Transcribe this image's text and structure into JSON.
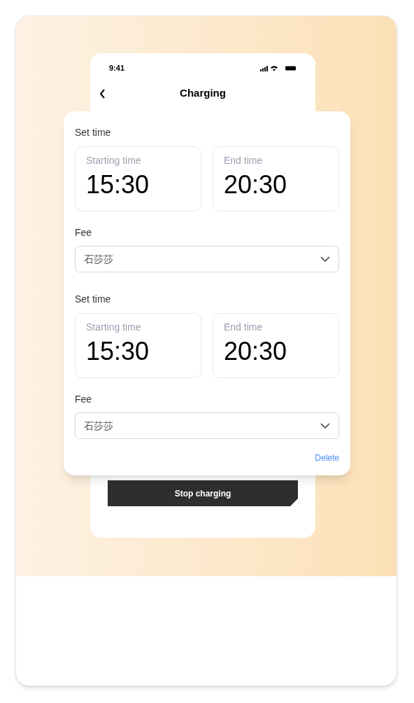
{
  "status_bar": {
    "time": "9:41"
  },
  "nav": {
    "title": "Charging"
  },
  "slots": [
    {
      "heading": "Set time",
      "start": {
        "label": "Starting time",
        "value": "15:30"
      },
      "end": {
        "label": "End time",
        "value": "20:30"
      },
      "fee_label": "Fee",
      "fee_value": "石莎莎"
    },
    {
      "heading": "Set time",
      "start": {
        "label": "Starting time",
        "value": "15:30"
      },
      "end": {
        "label": "End time",
        "value": "20:30"
      },
      "fee_label": "Fee",
      "fee_value": "石莎莎"
    }
  ],
  "delete": "Delete",
  "stop_button": "Stop charging"
}
